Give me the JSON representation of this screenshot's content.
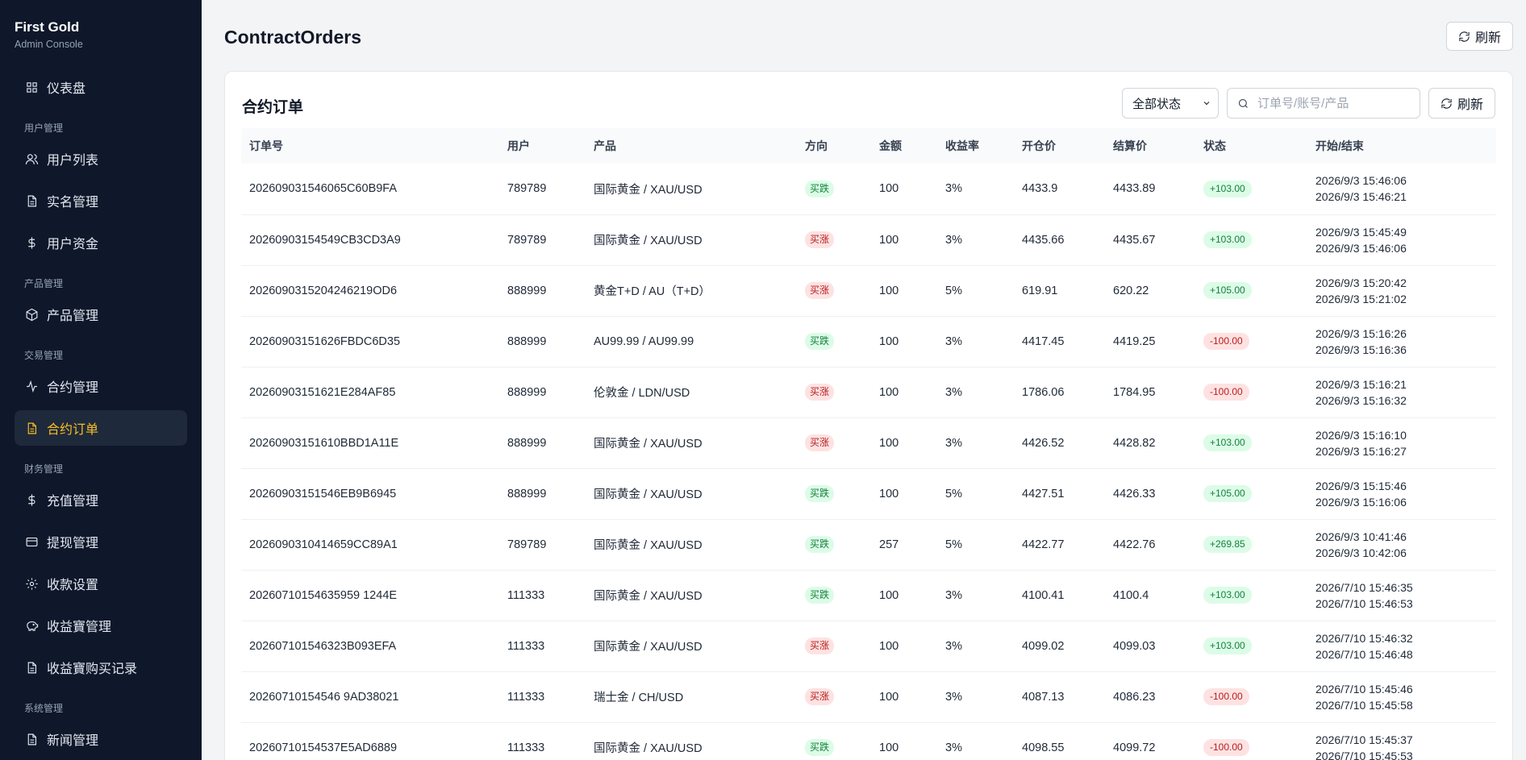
{
  "brand": {
    "title": "First Gold",
    "subtitle": "Admin Console"
  },
  "sidebar": {
    "items": [
      {
        "type": "item",
        "label": "仪表盘",
        "icon": "grid-icon",
        "active": false
      },
      {
        "type": "group",
        "label": "用户管理"
      },
      {
        "type": "item",
        "label": "用户列表",
        "icon": "users-icon",
        "active": false
      },
      {
        "type": "item",
        "label": "实名管理",
        "icon": "file-icon",
        "active": false
      },
      {
        "type": "item",
        "label": "用户资金",
        "icon": "dollar-icon",
        "active": false
      },
      {
        "type": "group",
        "label": "产品管理"
      },
      {
        "type": "item",
        "label": "产品管理",
        "icon": "box-icon",
        "active": false
      },
      {
        "type": "group",
        "label": "交易管理"
      },
      {
        "type": "item",
        "label": "合约管理",
        "icon": "activity-icon",
        "active": false
      },
      {
        "type": "item",
        "label": "合约订单",
        "icon": "file-icon",
        "active": true
      },
      {
        "type": "group",
        "label": "财务管理"
      },
      {
        "type": "item",
        "label": "充值管理",
        "icon": "dollar-icon",
        "active": false
      },
      {
        "type": "item",
        "label": "提现管理",
        "icon": "card-icon",
        "active": false
      },
      {
        "type": "item",
        "label": "收款设置",
        "icon": "gear-icon",
        "active": false
      },
      {
        "type": "item",
        "label": "收益寶管理",
        "icon": "piggy-icon",
        "active": false
      },
      {
        "type": "item",
        "label": "收益寶购买记录",
        "icon": "file-icon",
        "active": false
      },
      {
        "type": "group",
        "label": "系统管理"
      },
      {
        "type": "item",
        "label": "新闻管理",
        "icon": "file-icon",
        "active": false
      }
    ]
  },
  "header": {
    "title": "ContractOrders",
    "refresh_label": "刷新"
  },
  "card": {
    "title": "合约订单",
    "status_select": "全部状态",
    "search_placeholder": "订单号/账号/产品",
    "refresh_label": "刷新"
  },
  "colors": {
    "sidebar_bg": "#0f172a",
    "active_accent": "#fbbf24",
    "win": "#15803d",
    "lose": "#b91c1c"
  },
  "table": {
    "columns": [
      "订单号",
      "用户",
      "产品",
      "方向",
      "金额",
      "收益率",
      "开仓价",
      "结算价",
      "状态",
      "开始/结束"
    ],
    "rows": [
      {
        "order": "202609031546065C60B9FA",
        "user": "789789",
        "product": "国际黄金 / XAU/USD",
        "dir": "买跌",
        "dir_type": "up",
        "amount": "100",
        "rate": "3%",
        "open": "4433.9",
        "settle": "4433.89",
        "status": "+103.00",
        "status_type": "win",
        "start": "2026/9/3 15:46:06",
        "end": "2026/9/3 15:46:21"
      },
      {
        "order": "20260903154549CB3CD3A9",
        "user": "789789",
        "product": "国际黄金 / XAU/USD",
        "dir": "买涨",
        "dir_type": "down",
        "amount": "100",
        "rate": "3%",
        "open": "4435.66",
        "settle": "4435.67",
        "status": "+103.00",
        "status_type": "win",
        "start": "2026/9/3 15:45:49",
        "end": "2026/9/3 15:46:06"
      },
      {
        "order": "2026090315204246219OD6",
        "user": "888999",
        "product": "黄金T+D / AU（T+D）",
        "dir": "买涨",
        "dir_type": "down",
        "amount": "100",
        "rate": "5%",
        "open": "619.91",
        "settle": "620.22",
        "status": "+105.00",
        "status_type": "win",
        "start": "2026/9/3 15:20:42",
        "end": "2026/9/3 15:21:02"
      },
      {
        "order": "20260903151626FBDC6D35",
        "user": "888999",
        "product": "AU99.99 / AU99.99",
        "dir": "买跌",
        "dir_type": "up",
        "amount": "100",
        "rate": "3%",
        "open": "4417.45",
        "settle": "4419.25",
        "status": "-100.00",
        "status_type": "lose",
        "start": "2026/9/3 15:16:26",
        "end": "2026/9/3 15:16:36"
      },
      {
        "order": "20260903151621E284AF85",
        "user": "888999",
        "product": "伦敦金 / LDN/USD",
        "dir": "买涨",
        "dir_type": "down",
        "amount": "100",
        "rate": "3%",
        "open": "1786.06",
        "settle": "1784.95",
        "status": "-100.00",
        "status_type": "lose",
        "start": "2026/9/3 15:16:21",
        "end": "2026/9/3 15:16:32"
      },
      {
        "order": "20260903151610BBD1A11E",
        "user": "888999",
        "product": "国际黄金 / XAU/USD",
        "dir": "买涨",
        "dir_type": "down",
        "amount": "100",
        "rate": "3%",
        "open": "4426.52",
        "settle": "4428.82",
        "status": "+103.00",
        "status_type": "win",
        "start": "2026/9/3 15:16:10",
        "end": "2026/9/3 15:16:27"
      },
      {
        "order": "20260903151546EB9B6945",
        "user": "888999",
        "product": "国际黄金 / XAU/USD",
        "dir": "买跌",
        "dir_type": "up",
        "amount": "100",
        "rate": "5%",
        "open": "4427.51",
        "settle": "4426.33",
        "status": "+105.00",
        "status_type": "win",
        "start": "2026/9/3 15:15:46",
        "end": "2026/9/3 15:16:06"
      },
      {
        "order": "2026090310414659CC89A1",
        "user": "789789",
        "product": "国际黄金 / XAU/USD",
        "dir": "买跌",
        "dir_type": "up",
        "amount": "257",
        "rate": "5%",
        "open": "4422.77",
        "settle": "4422.76",
        "status": "+269.85",
        "status_type": "win",
        "start": "2026/9/3 10:41:46",
        "end": "2026/9/3 10:42:06"
      },
      {
        "order": "20260710154635959 1244E",
        "user": "111333",
        "product": "国际黄金 / XAU/USD",
        "dir": "买跌",
        "dir_type": "up",
        "amount": "100",
        "rate": "3%",
        "open": "4100.41",
        "settle": "4100.4",
        "status": "+103.00",
        "status_type": "win",
        "start": "2026/7/10 15:46:35",
        "end": "2026/7/10 15:46:53"
      },
      {
        "order": "202607101546323B093EFA",
        "user": "111333",
        "product": "国际黄金 / XAU/USD",
        "dir": "买涨",
        "dir_type": "down",
        "amount": "100",
        "rate": "3%",
        "open": "4099.02",
        "settle": "4099.03",
        "status": "+103.00",
        "status_type": "win",
        "start": "2026/7/10 15:46:32",
        "end": "2026/7/10 15:46:48"
      },
      {
        "order": "20260710154546 9AD38021",
        "user": "111333",
        "product": "瑞士金 / CH/USD",
        "dir": "买涨",
        "dir_type": "down",
        "amount": "100",
        "rate": "3%",
        "open": "4087.13",
        "settle": "4086.23",
        "status": "-100.00",
        "status_type": "lose",
        "start": "2026/7/10 15:45:46",
        "end": "2026/7/10 15:45:58"
      },
      {
        "order": "20260710154537E5AD6889",
        "user": "111333",
        "product": "国际黄金 / XAU/USD",
        "dir": "买跌",
        "dir_type": "up",
        "amount": "100",
        "rate": "3%",
        "open": "4098.55",
        "settle": "4099.72",
        "status": "-100.00",
        "status_type": "lose",
        "start": "2026/7/10 15:45:37",
        "end": "2026/7/10 15:45:53"
      }
    ]
  }
}
